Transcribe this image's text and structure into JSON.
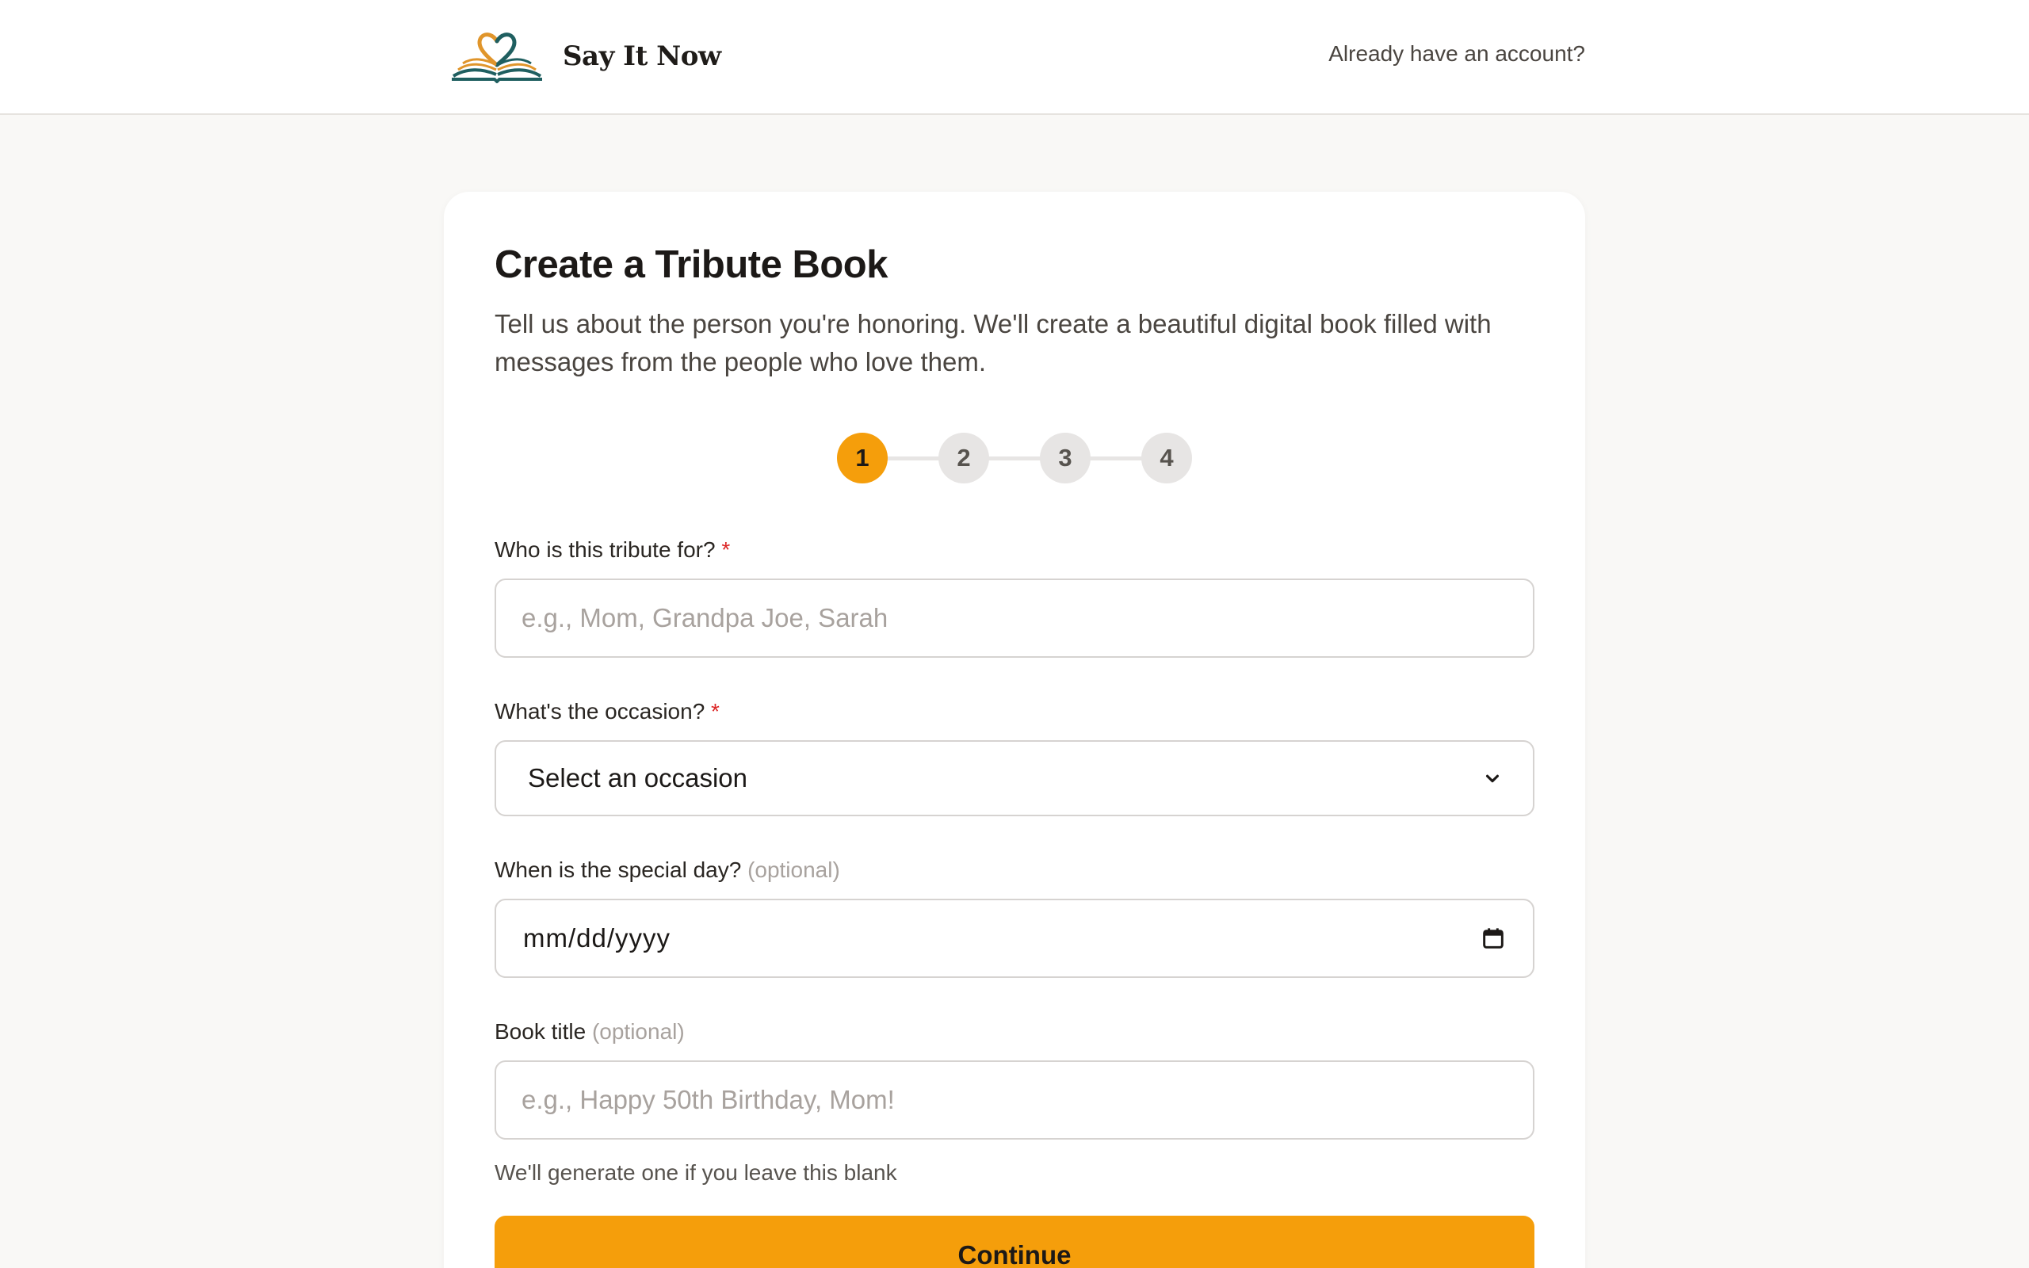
{
  "header": {
    "brand_name": "Say It Now",
    "logo_icon": "open-book-heart-icon",
    "login_link": "Already have an account?"
  },
  "form": {
    "title": "Create a Tribute Book",
    "subtitle": "Tell us about the person you're honoring. We'll create a beautiful digital book filled with messages from the people who love them.",
    "steps": [
      "1",
      "2",
      "3",
      "4"
    ],
    "active_step": 1,
    "recipient": {
      "label": "Who is this tribute for?",
      "required_mark": "*",
      "placeholder": "e.g., Mom, Grandpa Joe, Sarah",
      "value": ""
    },
    "occasion": {
      "label": "What's the occasion?",
      "required_mark": "*",
      "selected": "Select an occasion"
    },
    "special_day": {
      "label": "When is the special day?",
      "optional_note": "(optional)",
      "value_display": "mm/dd/yyyy"
    },
    "book_title": {
      "label": "Book title",
      "optional_note": "(optional)",
      "placeholder": "e.g., Happy 50th Birthday, Mom!",
      "value": "",
      "hint": "We'll generate one if you leave this blank"
    },
    "continue_label": "Continue"
  },
  "colors": {
    "accent": "#f59e0b",
    "page_bg": "#f9f8f6",
    "required": "#dc2626",
    "step_inactive": "#e7e5e4",
    "logo_teal": "#1f5f60",
    "logo_orange": "#e0952b"
  }
}
